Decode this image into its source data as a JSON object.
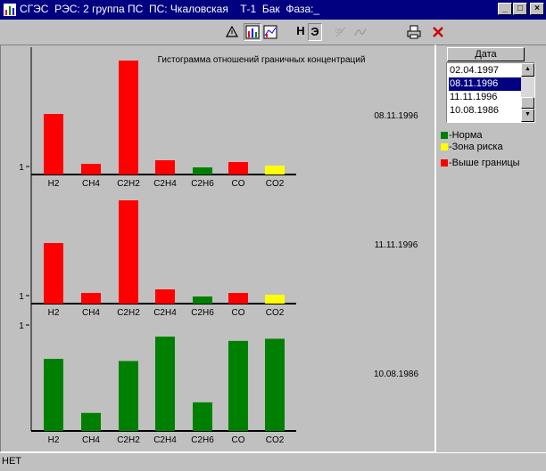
{
  "window": {
    "title": "СГЭС  РЭС: 2 группа ПС  ПС: Чкаловская    Т-1  Бак  Фаза:_",
    "minimize": "_",
    "maximize": "□",
    "close": "×"
  },
  "toolbar": {
    "h_label": "Н",
    "e_label": "Э",
    "icons": [
      "triangle-icon",
      "histogram-icon",
      "chart-icon",
      "scale-icon",
      "wave-icon",
      "print-icon",
      "close-x-icon"
    ]
  },
  "side": {
    "date_header": "Дата",
    "dates": [
      "02.04.1997",
      "08.11.1996",
      "11.11.1996",
      "10.08.1986"
    ],
    "selected_index": 1,
    "legend": [
      {
        "label": "-Норма",
        "color": "#008000"
      },
      {
        "label": "-Зона риска",
        "color": "#ffff00"
      },
      {
        "label": "-Выше границы",
        "color": "#ff0000"
      }
    ]
  },
  "status": {
    "text": "НЕТ"
  },
  "chart_data": {
    "type": "bar",
    "title": "Гистограмма отношений граничных концентраций",
    "categories": [
      "H2",
      "CH4",
      "C2H2",
      "C2H4",
      "C2H6",
      "CO",
      "CO2"
    ],
    "y_tick_label": "1",
    "panels": [
      {
        "date": "08.11.1996",
        "values": [
          1.7,
          0.3,
          3.2,
          0.4,
          0.2,
          0.35,
          0.25
        ],
        "colors": [
          "#ff0000",
          "#ff0000",
          "#ff0000",
          "#ff0000",
          "#008000",
          "#ff0000",
          "#ffff00"
        ]
      },
      {
        "date": "11.11.1996",
        "values": [
          1.7,
          0.3,
          2.9,
          0.4,
          0.2,
          0.3,
          0.25
        ],
        "colors": [
          "#ff0000",
          "#ff0000",
          "#ff0000",
          "#ff0000",
          "#008000",
          "#ff0000",
          "#ffff00"
        ]
      },
      {
        "date": "10.08.1986",
        "values": [
          0.68,
          0.17,
          0.66,
          0.89,
          0.27,
          0.85,
          0.87
        ],
        "colors": [
          "#008000",
          "#008000",
          "#008000",
          "#008000",
          "#008000",
          "#008000",
          "#008000"
        ]
      }
    ]
  }
}
